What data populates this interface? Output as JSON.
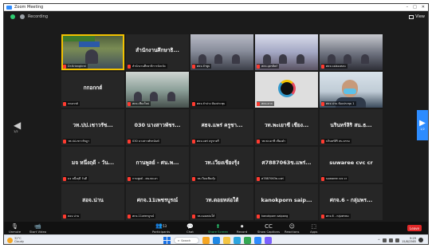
{
  "window": {
    "title": "Zoom Meeting",
    "controls": [
      "–",
      "□",
      "✕"
    ]
  },
  "topbar": {
    "meeting_info": "Recording",
    "view_label": "View"
  },
  "tiles": [
    {
      "name": "",
      "label": "Dr.Kriangkrai",
      "photo": "photo-a",
      "kind": "speaker",
      "active": true
    },
    {
      "name": "สำนักงานศึกษาธิ...",
      "label": "สำนักงานศึกษาธิการจังหวัด",
      "photo": "",
      "kind": "name"
    },
    {
      "name": "",
      "label": "ศธจ.ลำพูน",
      "photo": "photo-b",
      "kind": "room"
    },
    {
      "name": "",
      "label": "ศธจ.อุตรดิตถ์",
      "photo": "photo-c",
      "kind": "room"
    },
    {
      "name": "",
      "label": "ศธจ.แม่ฮ่องสอน",
      "photo": "photo-d",
      "kind": "room"
    },
    {
      "name": "กกอกกต์",
      "label": "กกอกกต์",
      "photo": "",
      "kind": "name"
    },
    {
      "name": "",
      "label": "ศธจ.เชียงใหม่",
      "photo": "photo-e",
      "kind": "room"
    },
    {
      "name": "",
      "label": "ศธจ.ลำปาง ห้องประชุม",
      "photo": "photo-g",
      "kind": "blank"
    },
    {
      "name": "",
      "label": "ศธจ.ตาก",
      "photo": "photo-h",
      "kind": "ring"
    },
    {
      "name": "",
      "label": "ศธจ.น่าน ห้องประชุม 1",
      "photo": "photo-i",
      "kind": "masked"
    },
    {
      "name": "วท.ปป.เชาวรัช...",
      "label": "วท.ปป.เชาวรัชฎา",
      "photo": "",
      "kind": "name"
    },
    {
      "name": "030 นางสาวพัชร...",
      "label": "030 นางสาวพัชรนันท์",
      "photo": "",
      "kind": "name"
    },
    {
      "name": "ศธจ.แพร่ ครูชา...",
      "label": "ศธจ.แพร่ ครูชาตรี",
      "photo": "",
      "kind": "name"
    },
    {
      "name": "วท.พะเยาซี เชียง...",
      "label": "วท.พะเยาซี เชียงคำ",
      "photo": "",
      "kind": "name"
    },
    {
      "name": "นรินทร์ลิริ สน.ธ...",
      "label": "นรินทร์ลิริ สน.ธรรม",
      "photo": "",
      "kind": "name"
    },
    {
      "name": "มจ หนึ่งฤดี - วัน...",
      "label": "มจ หนึ่งฤดี วันดี",
      "photo": "",
      "kind": "name"
    },
    {
      "name": "กานพูลย์ - ศน.พ...",
      "label": "กานพูลย์ - ศน.พะเยา",
      "photo": "",
      "kind": "name"
    },
    {
      "name": "วท.เวียงเชียงรุ้ง",
      "label": "วท.เวียงเชียงรุ้ง",
      "photo": "",
      "kind": "name"
    },
    {
      "name": "ศ7887063ข.แพร่...",
      "label": "ศ7887063ข.แพร่",
      "photo": "",
      "kind": "name"
    },
    {
      "name": "suwaree cvc cr",
      "label": "suwaree cvc cr",
      "photo": "",
      "kind": "name"
    },
    {
      "name": "สอจ.น่าน",
      "label": "สอจ.น่าน",
      "photo": "",
      "kind": "name"
    },
    {
      "name": "ศกจ.11เพชรบูรณ์",
      "label": "ศกจ.11เพชรบูรณ์",
      "photo": "",
      "kind": "name"
    },
    {
      "name": "วท.ดอยหล่อใต้",
      "label": "วท.ดอยหล่อใต้",
      "photo": "",
      "kind": "name"
    },
    {
      "name": "kanokporn saip...",
      "label": "kanokporn saipang",
      "photo": "",
      "kind": "name"
    },
    {
      "name": "ศกจ.6 - กลุ่มพร...",
      "label": "ศกจ.6 - กลุ่มพรหม",
      "photo": "",
      "kind": "name"
    }
  ],
  "pager": {
    "left": "1/2",
    "right": "1/2"
  },
  "toolbar": {
    "unmute": "Unmute",
    "start_video": "Start Video",
    "participants": "Participants",
    "participants_count": "53",
    "chat": "Chat",
    "share_screen": "Share Screen",
    "record": "Record",
    "show_captions": "Show Captions",
    "reactions": "Reactions",
    "apps": "Apps",
    "leave": "Leave"
  },
  "taskbar": {
    "weather_temp": "32°C",
    "weather_desc": "Cloudy",
    "search_label": "Search",
    "time": "9:29",
    "date": "15/8/2565",
    "apps": [
      "#f5a623",
      "#1e88e5",
      "#f4c542",
      "#2ca5e0",
      "#34a853",
      "#2d8cff",
      "#7b61ff"
    ]
  },
  "colors": {
    "accent": "#2d8cff",
    "active_speaker": "#f2c200",
    "leave": "#e02828",
    "share": "#28c76f"
  }
}
